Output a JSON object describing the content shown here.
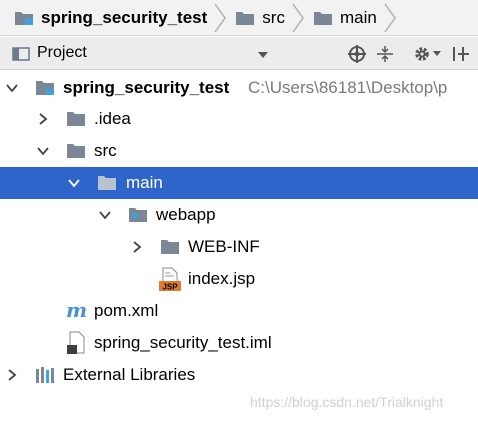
{
  "breadcrumb": {
    "items": [
      {
        "label": "spring_security_test",
        "icon": "module-folder-icon"
      },
      {
        "label": "src",
        "icon": "folder-icon"
      },
      {
        "label": "main",
        "icon": "folder-icon"
      }
    ]
  },
  "project_panel": {
    "title": "Project",
    "tools": [
      "locate-icon",
      "collapse-all-icon",
      "gear-icon",
      "hide-panel-icon"
    ]
  },
  "tree": {
    "root": {
      "label": "spring_security_test",
      "path": "C:\\Users\\86181\\Desktop\\p"
    },
    "idea": {
      "label": ".idea"
    },
    "src": {
      "label": "src"
    },
    "main": {
      "label": "main"
    },
    "webapp": {
      "label": "webapp"
    },
    "webinf": {
      "label": "WEB-INF"
    },
    "indexjsp": {
      "label": "index.jsp",
      "badge": "JSP"
    },
    "pom": {
      "label": "pom.xml"
    },
    "iml": {
      "label": "spring_security_test.iml"
    },
    "extlibs": {
      "label": "External Libraries"
    }
  },
  "watermark": "https://blog.csdn.net/Trialknight",
  "colors": {
    "selection": "#2f65ca",
    "folder": "#7b8796",
    "maven": "#4a90d9",
    "jsp_badge": "#e07a2e"
  }
}
